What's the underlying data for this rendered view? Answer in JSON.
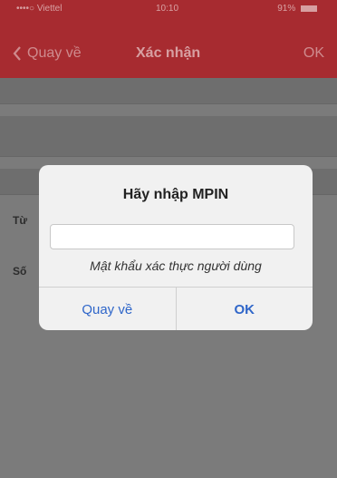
{
  "status_bar": {
    "carrier": "••••○ Viettel",
    "time": "10:10",
    "battery": "91%"
  },
  "nav": {
    "back_label": "Quay về",
    "title": "Xác nhận",
    "ok_label": "OK"
  },
  "form": {
    "row_from_label": "Từ",
    "row_number_label": "Số"
  },
  "dialog": {
    "title": "Hãy nhập MPIN",
    "input_value": "",
    "caption": "Mật khẩu xác thực người dùng",
    "cancel_label": "Quay về",
    "ok_label": "OK"
  },
  "colors": {
    "header": "#a72b30",
    "dialog_button": "#2f66c9"
  }
}
